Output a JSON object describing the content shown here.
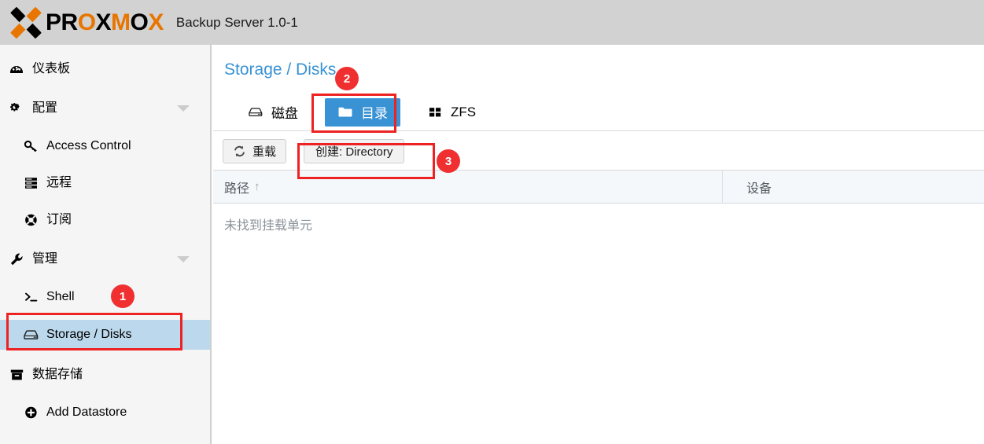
{
  "header": {
    "brand_dark": "PR",
    "brand_accent_1": "O",
    "brand_dark_2": "X",
    "brand_accent_2": "M",
    "brand_dark_3": "O",
    "brand_accent_3": "X",
    "logo_text_full": "PROXMOX",
    "product_title": "Backup Server 1.0-1",
    "logo_icon": "proxmox-x-logo",
    "bg_color": "#d2d2d2"
  },
  "sidebar": {
    "bg_color": "#f5f5f5",
    "selected_color": "#bcd8ec",
    "items": [
      {
        "label": "仪表板",
        "icon": "dashboard-icon",
        "level": "top",
        "expandable": false,
        "selected": false
      },
      {
        "label": "配置",
        "icon": "gears-icon",
        "level": "top",
        "expandable": true,
        "selected": false
      },
      {
        "label": "Access Control",
        "icon": "key-icon",
        "level": "child",
        "expandable": false,
        "selected": false
      },
      {
        "label": "远程",
        "icon": "server-icon",
        "level": "child",
        "expandable": false,
        "selected": false
      },
      {
        "label": "订阅",
        "icon": "lifebuoy-icon",
        "level": "child",
        "expandable": false,
        "selected": false
      },
      {
        "label": "管理",
        "icon": "wrench-icon",
        "level": "top",
        "expandable": true,
        "selected": false
      },
      {
        "label": "Shell",
        "icon": "terminal-icon",
        "level": "child",
        "expandable": false,
        "selected": false
      },
      {
        "label": "Storage / Disks",
        "icon": "hard-drive-icon",
        "level": "child",
        "expandable": false,
        "selected": true
      },
      {
        "label": "数据存储",
        "icon": "archive-box-icon",
        "level": "top",
        "expandable": false,
        "selected": false
      },
      {
        "label": "Add Datastore",
        "icon": "plus-circle-icon",
        "level": "child",
        "expandable": false,
        "selected": false
      }
    ]
  },
  "main": {
    "page_title": "Storage / Disks",
    "title_color": "#3892d4",
    "tabs": [
      {
        "label": "磁盘",
        "icon": "hard-drive-icon",
        "active": false
      },
      {
        "label": "目录",
        "icon": "folder-icon",
        "active": true
      },
      {
        "label": "ZFS",
        "icon": "grid-squares-icon",
        "active": false
      }
    ],
    "active_tab_color": "#3892d4",
    "toolbar": {
      "reload_label": "重载",
      "reload_icon": "refresh-icon",
      "create_label": "创建: Directory"
    },
    "table": {
      "columns": [
        {
          "label": "路径",
          "sort": "↑"
        },
        {
          "label": "设备",
          "sort": ""
        }
      ],
      "rows": [],
      "empty_text": "未找到挂载单元"
    }
  },
  "annotations": {
    "color": "#ee2222",
    "badge_color": "#f03030",
    "markers": [
      {
        "number": "1",
        "target": "sidebar-item-storage-disks"
      },
      {
        "number": "2",
        "target": "tab-directory"
      },
      {
        "number": "3",
        "target": "create-directory-button"
      }
    ]
  }
}
